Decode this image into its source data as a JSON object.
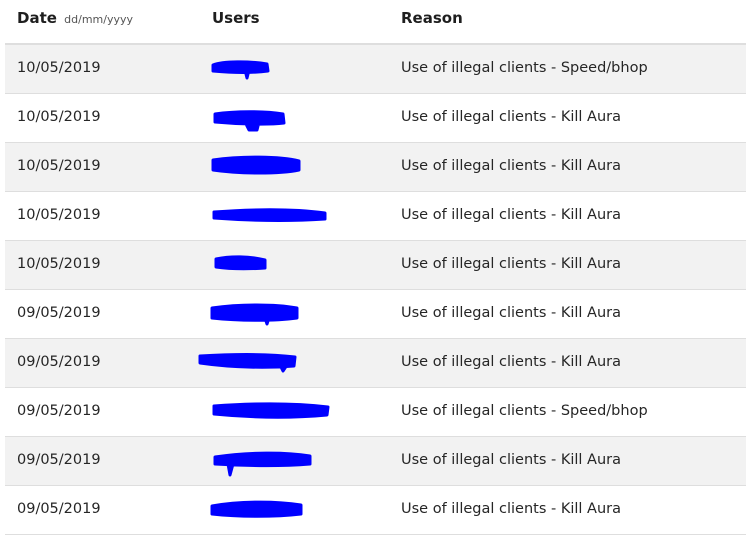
{
  "headers": {
    "date": "Date",
    "date_format": "dd/mm/yyyy",
    "users": "Users",
    "reason": "Reason"
  },
  "redaction_color": "#0000ff",
  "rows": [
    {
      "date": "10/05/2019",
      "reason": "Use of illegal clients - Speed/bhop"
    },
    {
      "date": "10/05/2019",
      "reason": "Use of illegal clients - Kill Aura"
    },
    {
      "date": "10/05/2019",
      "reason": "Use of illegal clients - Kill Aura"
    },
    {
      "date": "10/05/2019",
      "reason": "Use of illegal clients - Kill Aura"
    },
    {
      "date": "10/05/2019",
      "reason": "Use of illegal clients - Kill Aura"
    },
    {
      "date": "09/05/2019",
      "reason": "Use of illegal clients - Kill Aura"
    },
    {
      "date": "09/05/2019",
      "reason": "Use of illegal clients - Kill Aura"
    },
    {
      "date": "09/05/2019",
      "reason": "Use of illegal clients - Speed/bhop"
    },
    {
      "date": "09/05/2019",
      "reason": "Use of illegal clients - Kill Aura"
    },
    {
      "date": "09/05/2019",
      "reason": "Use of illegal clients - Kill Aura"
    }
  ]
}
